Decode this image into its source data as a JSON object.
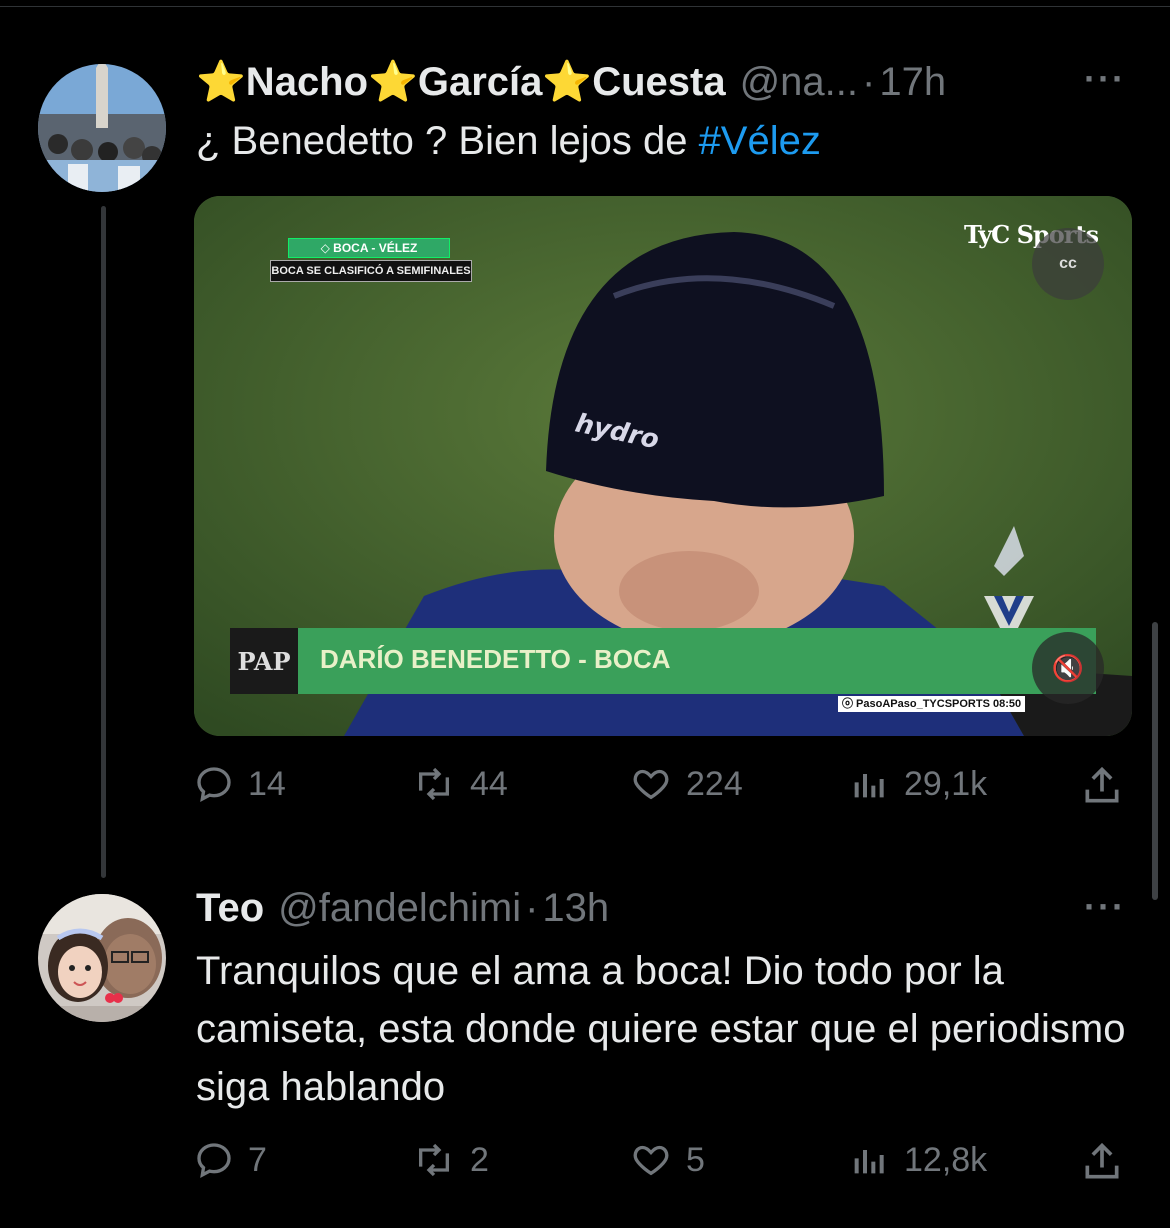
{
  "tweets": [
    {
      "display_name": "⭐Nacho⭐García⭐Cuesta",
      "handle": "@na...",
      "separator": "·",
      "time": "17h",
      "more": "···",
      "text_before": "¿ Benedetto ? Bien lejos de ",
      "hashtag": "#Vélez",
      "media": {
        "scoreboard_match": "◇ BOCA - VÉLEZ",
        "scoreboard_caption": "BOCA SE CLASIFICÓ A SEMIFINALES",
        "broadcaster": "TyC Sports",
        "cc_icon": "cc",
        "lower_third_logo": "PAP",
        "lower_third_name": "DARÍO BENEDETTO - BOCA",
        "credit": "ⓞ PasoAPaso_TYCSPORTS  08:50",
        "cap_brand": "hydro",
        "mute_icon": "🔇"
      },
      "metrics": {
        "replies": "14",
        "reposts": "44",
        "likes": "224",
        "views": "29,1k"
      }
    },
    {
      "display_name": "Teo",
      "handle": "@fandelchimi",
      "separator": "·",
      "time": "13h",
      "more": "···",
      "text": "Tranquilos que el ama a boca! Dio todo por la camiseta, esta donde quiere estar que el periodismo siga hablando",
      "metrics": {
        "replies": "7",
        "reposts": "2",
        "likes": "5",
        "views": "12,8k"
      }
    }
  ],
  "colors": {
    "background": "#000000",
    "text": "#e7e9ea",
    "muted": "#71767b",
    "link": "#1d9bf0"
  }
}
